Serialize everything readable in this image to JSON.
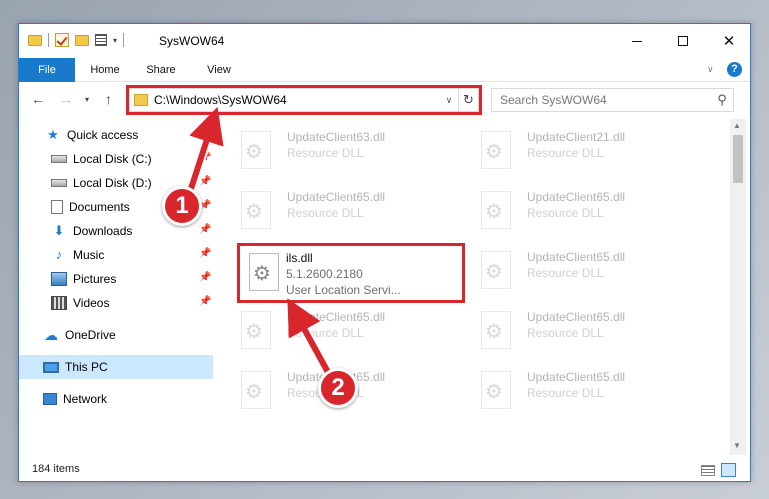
{
  "window": {
    "title": "SysWOW64"
  },
  "ribbon": {
    "tabs": [
      "File",
      "Home",
      "Share",
      "View"
    ]
  },
  "address": {
    "path": "C:\\Windows\\SysWOW64",
    "search_placeholder": "Search SysWOW64"
  },
  "sidebar": {
    "items": [
      {
        "label": "Quick access",
        "icon": "star-icon",
        "pinned": false
      },
      {
        "label": "Local Disk (C:)",
        "icon": "disk-icon",
        "pinned": true
      },
      {
        "label": "Local Disk (D:)",
        "icon": "disk-icon",
        "pinned": true
      },
      {
        "label": "Documents",
        "icon": "documents-icon",
        "pinned": true
      },
      {
        "label": "Downloads",
        "icon": "download-icon",
        "pinned": true
      },
      {
        "label": "Music",
        "icon": "music-icon",
        "pinned": true
      },
      {
        "label": "Pictures",
        "icon": "pictures-icon",
        "pinned": true
      },
      {
        "label": "Videos",
        "icon": "videos-icon",
        "pinned": true
      },
      {
        "label": "OneDrive",
        "icon": "cloud-icon",
        "pinned": false
      },
      {
        "label": "This PC",
        "icon": "computer-icon",
        "pinned": false,
        "selected": true
      },
      {
        "label": "Network",
        "icon": "network-icon",
        "pinned": false
      }
    ]
  },
  "files": {
    "left": [
      {
        "name": "UpdateClient63.dll",
        "desc": "Resource DLL"
      },
      {
        "name": "UpdateClient65.dll",
        "desc": "Resource DLL"
      },
      {
        "name": "ils.dll",
        "desc": "5.1.2600.2180",
        "desc2": "User Location Servi...",
        "highlighted": true
      },
      {
        "name": "UpdateClient65.dll",
        "desc": "Resource DLL"
      },
      {
        "name": "UpdateClient65.dll",
        "desc": "Resource DLL"
      }
    ],
    "right": [
      {
        "name": "UpdateClient21.dll",
        "desc": "Resource DLL"
      },
      {
        "name": "UpdateClient65.dll",
        "desc": "Resource DLL"
      },
      {
        "name": "UpdateClient65.dll",
        "desc": "Resource DLL"
      },
      {
        "name": "UpdateClient65.dll",
        "desc": "Resource DLL"
      },
      {
        "name": "UpdateClient65.dll",
        "desc": "Resource DLL"
      }
    ]
  },
  "status": {
    "item_count": "184 items"
  },
  "annotations": {
    "badge1": "1",
    "badge2": "2",
    "color": "#d9262c"
  },
  "colors": {
    "accent": "#1979ca",
    "selected": "#cce8ff",
    "highlight": "#d9262c"
  }
}
